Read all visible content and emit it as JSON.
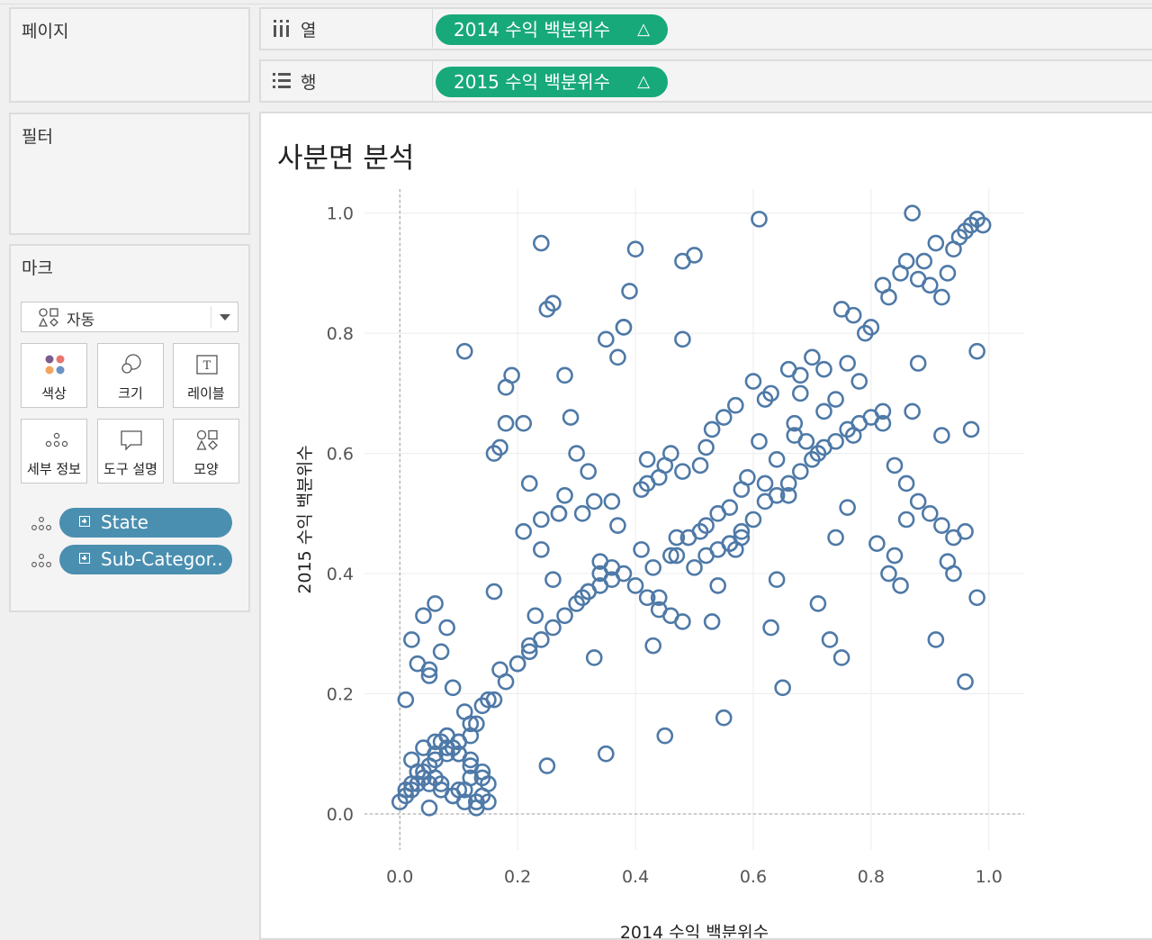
{
  "pages_panel": {
    "title": "페이지"
  },
  "filters_panel": {
    "title": "필터"
  },
  "marks_panel": {
    "title": "마크",
    "mark_type": "자동",
    "buttons": [
      {
        "label": "색상",
        "icon": "color-icon"
      },
      {
        "label": "크기",
        "icon": "size-icon"
      },
      {
        "label": "레이블",
        "icon": "label-icon"
      },
      {
        "label": "세부 정보",
        "icon": "detail-icon"
      },
      {
        "label": "도구 설명",
        "icon": "tooltip-icon"
      },
      {
        "label": "모양",
        "icon": "shape-icon"
      }
    ],
    "fields": [
      {
        "label": "State",
        "type": "detail"
      },
      {
        "label": "Sub-Categor..",
        "type": "detail"
      }
    ]
  },
  "columns_shelf": {
    "label": "열",
    "pill": "2014 수익 백분위수",
    "delta": "△"
  },
  "rows_shelf": {
    "label": "행",
    "pill": "2015 수익 백분위수",
    "delta": "△"
  },
  "viz": {
    "title": "사분면 분석"
  },
  "colors": {
    "pill_green": "#17a97a",
    "pill_blue": "#4a8fb0",
    "mark": "#4e79a7"
  },
  "chart_data": {
    "type": "scatter",
    "title": "사분면 분석",
    "xlabel": "2014 수익 백분위수",
    "ylabel": "2015 수익 백분위수",
    "xlim": [
      -0.06,
      1.06
    ],
    "ylim": [
      -0.06,
      1.04
    ],
    "xticks": [
      "0.0",
      "0.2",
      "0.4",
      "0.6",
      "0.8",
      "1.0"
    ],
    "yticks": [
      "0.0",
      "0.2",
      "0.4",
      "0.6",
      "0.8",
      "1.0"
    ],
    "grid": true,
    "reference_lines": {
      "x": 0.0,
      "y": 0.0
    },
    "marker": "open-circle",
    "x": [
      0.24,
      0.4,
      0.61,
      0.5,
      0.48,
      0.39,
      0.35,
      0.26,
      0.25,
      0.11,
      0.37,
      0.38,
      0.19,
      0.29,
      0.3,
      0.21,
      0.16,
      0.18,
      0.28,
      0.33,
      0.27,
      0.24,
      0.36,
      0.42,
      0.45,
      0.44,
      0.46,
      0.48,
      0.53,
      0.55,
      0.57,
      0.6,
      0.63,
      0.66,
      0.68,
      0.7,
      0.72,
      0.75,
      0.77,
      0.8,
      0.83,
      0.85,
      0.86,
      0.88,
      0.9,
      0.92,
      0.93,
      0.95,
      0.96,
      0.97,
      0.98,
      0.99,
      0.87,
      0.91,
      0.94,
      0.89,
      0.82,
      0.79,
      0.76,
      0.74,
      0.71,
      0.69,
      0.67,
      0.64,
      0.62,
      0.59,
      0.58,
      0.56,
      0.54,
      0.52,
      0.51,
      0.49,
      0.47,
      0.43,
      0.41,
      0.34,
      0.32,
      0.31,
      0.23,
      0.22,
      0.2,
      0.17,
      0.15,
      0.14,
      0.13,
      0.12,
      0.1,
      0.09,
      0.08,
      0.07,
      0.06,
      0.05,
      0.04,
      0.03,
      0.02,
      0.01,
      0.0,
      0.03,
      0.05,
      0.07,
      0.09,
      0.11,
      0.13,
      0.14,
      0.15,
      0.12,
      0.1,
      0.08,
      0.06,
      0.04,
      0.02,
      0.01,
      0.06,
      0.08,
      0.1,
      0.12,
      0.14,
      0.16,
      0.18,
      0.2,
      0.22,
      0.24,
      0.26,
      0.28,
      0.3,
      0.32,
      0.34,
      0.36,
      0.38,
      0.4,
      0.42,
      0.44,
      0.46,
      0.48,
      0.5,
      0.52,
      0.54,
      0.56,
      0.58,
      0.6,
      0.62,
      0.64,
      0.66,
      0.68,
      0.7,
      0.72,
      0.74,
      0.76,
      0.78,
      0.8,
      0.82,
      0.84,
      0.86,
      0.88,
      0.9,
      0.92,
      0.94,
      0.96,
      0.98,
      0.85,
      0.75,
      0.65,
      0.55,
      0.45,
      0.35,
      0.25,
      0.15,
      0.05,
      0.33,
      0.43,
      0.53,
      0.63,
      0.73,
      0.83,
      0.93,
      0.57,
      0.47,
      0.37,
      0.27,
      0.17,
      0.77,
      0.67,
      0.87,
      0.97,
      0.61,
      0.51,
      0.41,
      0.31,
      0.21,
      0.81,
      0.71,
      0.91,
      0.44,
      0.54,
      0.64,
      0.74,
      0.84,
      0.94,
      0.34,
      0.24,
      0.58,
      0.68,
      0.78,
      0.88,
      0.98,
      0.48,
      0.38,
      0.28,
      0.18,
      0.62,
      0.72,
      0.82,
      0.92,
      0.52,
      0.42,
      0.32,
      0.22,
      0.66,
      0.76,
      0.86,
      0.96,
      0.56,
      0.46,
      0.36,
      0.26,
      0.16,
      0.06,
      0.04,
      0.08,
      0.02,
      0.07,
      0.03,
      0.05,
      0.09,
      0.01,
      0.11,
      0.12,
      0.13,
      0.1,
      0.14,
      0.09,
      0.07,
      0.05,
      0.03,
      0.02,
      0.04,
      0.06,
      0.08,
      0.1,
      0.12,
      0.11,
      0.13
    ],
    "y": [
      0.95,
      0.94,
      0.99,
      0.93,
      0.92,
      0.87,
      0.79,
      0.85,
      0.84,
      0.77,
      0.76,
      0.81,
      0.73,
      0.66,
      0.6,
      0.65,
      0.6,
      0.65,
      0.53,
      0.52,
      0.5,
      0.49,
      0.52,
      0.55,
      0.58,
      0.56,
      0.6,
      0.57,
      0.64,
      0.66,
      0.68,
      0.72,
      0.7,
      0.74,
      0.73,
      0.76,
      0.74,
      0.84,
      0.83,
      0.81,
      0.86,
      0.9,
      0.92,
      0.89,
      0.88,
      0.86,
      0.9,
      0.96,
      0.97,
      0.98,
      0.99,
      0.98,
      1.0,
      0.95,
      0.94,
      0.92,
      0.88,
      0.8,
      0.75,
      0.69,
      0.6,
      0.62,
      0.63,
      0.59,
      0.55,
      0.56,
      0.54,
      0.51,
      0.5,
      0.48,
      0.47,
      0.46,
      0.43,
      0.41,
      0.44,
      0.4,
      0.37,
      0.36,
      0.33,
      0.28,
      0.25,
      0.24,
      0.19,
      0.18,
      0.15,
      0.13,
      0.12,
      0.11,
      0.13,
      0.12,
      0.1,
      0.08,
      0.06,
      0.05,
      0.04,
      0.03,
      0.02,
      0.07,
      0.05,
      0.04,
      0.03,
      0.02,
      0.01,
      0.03,
      0.05,
      0.08,
      0.1,
      0.11,
      0.09,
      0.07,
      0.05,
      0.04,
      0.06,
      0.1,
      0.12,
      0.09,
      0.07,
      0.19,
      0.22,
      0.25,
      0.27,
      0.29,
      0.31,
      0.33,
      0.35,
      0.37,
      0.38,
      0.39,
      0.4,
      0.38,
      0.36,
      0.34,
      0.33,
      0.32,
      0.41,
      0.43,
      0.44,
      0.45,
      0.47,
      0.49,
      0.52,
      0.53,
      0.55,
      0.57,
      0.59,
      0.61,
      0.62,
      0.64,
      0.65,
      0.66,
      0.67,
      0.58,
      0.55,
      0.52,
      0.5,
      0.48,
      0.46,
      0.22,
      0.36,
      0.38,
      0.26,
      0.21,
      0.16,
      0.13,
      0.1,
      0.08,
      0.02,
      0.24,
      0.26,
      0.28,
      0.32,
      0.31,
      0.29,
      0.4,
      0.42,
      0.44,
      0.46,
      0.48,
      0.5,
      0.61,
      0.63,
      0.65,
      0.67,
      0.64,
      0.62,
      0.58,
      0.54,
      0.5,
      0.47,
      0.45,
      0.35,
      0.29,
      0.36,
      0.38,
      0.39,
      0.46,
      0.43,
      0.4,
      0.42,
      0.44,
      0.46,
      0.7,
      0.72,
      0.75,
      0.77,
      0.79,
      0.81,
      0.73,
      0.71,
      0.69,
      0.67,
      0.65,
      0.63,
      0.61,
      0.59,
      0.57,
      0.55,
      0.53,
      0.51,
      0.49,
      0.47,
      0.45,
      0.43,
      0.41,
      0.39,
      0.37,
      0.35,
      0.33,
      0.31,
      0.29,
      0.27,
      0.25,
      0.23,
      0.21,
      0.19,
      0.17,
      0.15,
      0.02,
      0.04,
      0.06,
      0.03,
      0.05,
      0.01,
      0.07,
      0.09,
      0.11,
      0.12,
      0.13,
      0.1,
      0.06,
      0.04,
      0.02,
      0.01,
      0.03,
      0.05,
      0.08,
      0.09,
      0.12,
      0.11
    ]
  }
}
